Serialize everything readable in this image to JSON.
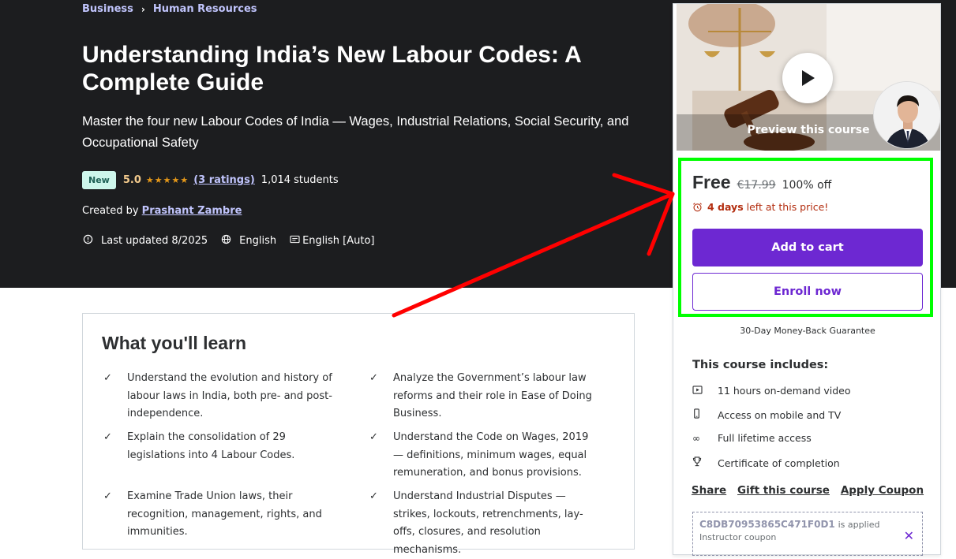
{
  "breadcrumb": {
    "items": [
      "Business",
      "Human Resources"
    ]
  },
  "course": {
    "title": "Understanding India’s New Labour Codes: A Complete Guide",
    "subtitle": "Master the four new Labour Codes of India — Wages, Industrial Relations, Social Security, and Occupational Safety",
    "badge": "New",
    "rating": "5.0",
    "ratings_count": "(3 ratings)",
    "students": "1,014 students",
    "created_by_label": "Created by",
    "instructor": "Prashant Zambre",
    "last_updated": "Last updated 8/2025",
    "language": "English",
    "captions": "English [Auto]"
  },
  "learn": {
    "title": "What you'll learn",
    "items": [
      "Understand the evolution and history of labour laws in India, both pre- and post-independence.",
      "Analyze the Government’s labour law reforms and their role in Ease of Doing Business.",
      "Explain the consolidation of 29 legislations into 4 Labour Codes.",
      "Understand the Code on Wages, 2019 — definitions, minimum wages, equal remuneration, and bonus provisions.",
      "Examine Trade Union laws, their recognition, management, rights, and immunities.",
      "Understand Industrial Disputes — strikes, lockouts, retrenchments, lay-offs, closures, and resolution mechanisms."
    ]
  },
  "sidebar": {
    "preview_label": "Preview this course",
    "price": "Free",
    "original_price": "€17.99",
    "discount": "100% off",
    "deadline_bold": "4 days",
    "deadline_rest": "left at this price!",
    "add_to_cart": "Add to cart",
    "enroll_now": "Enroll now",
    "guarantee": "30-Day Money-Back Guarantee",
    "includes_title": "This course includes:",
    "includes": [
      {
        "icon": "video-icon",
        "label": "11 hours on-demand video"
      },
      {
        "icon": "mobile-icon",
        "label": "Access on mobile and TV"
      },
      {
        "icon": "infinity-icon",
        "label": "Full lifetime access"
      },
      {
        "icon": "trophy-icon",
        "label": "Certificate of completion"
      }
    ],
    "links": [
      "Share",
      "Gift this course",
      "Apply Coupon"
    ],
    "coupon_code": "C8DB70953865C471F0D1",
    "coupon_applied": "is applied",
    "coupon_type": "Instructor coupon"
  },
  "colors": {
    "hero_bg": "#1c1d1f",
    "accent_purple": "#6d28d2",
    "link_lavender": "#c0c4fc",
    "rating_gold": "#e59819",
    "annotation_red": "#ff0000",
    "annotation_green": "#00ff00"
  }
}
